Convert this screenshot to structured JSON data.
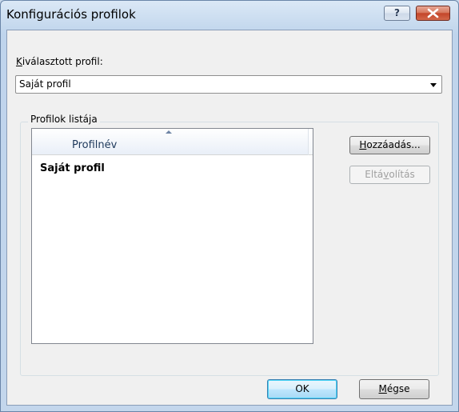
{
  "window": {
    "title": "Konfigurációs profilok",
    "help_label": "?",
    "close_icon": "close-x-icon"
  },
  "selected_profile": {
    "label_prefix": "",
    "label_underlined": "K",
    "label_rest": "iválasztott profil:",
    "value": "Saját profil"
  },
  "profiles_group": {
    "legend": "Profilok listája",
    "column_header": "Profilnév",
    "sort_direction": "ascending",
    "rows": [
      "Saját profil"
    ]
  },
  "buttons": {
    "add": {
      "underlined": "H",
      "rest": "ozzáadás...",
      "enabled": true
    },
    "remove": {
      "prefix": "Eltá",
      "underlined": "v",
      "rest": "olítás",
      "enabled": false
    },
    "ok": "OK",
    "cancel": {
      "underlined": "M",
      "rest": "égse"
    }
  },
  "colors": {
    "close_button": "#c4452a",
    "default_button_border": "#3c7fb1",
    "disabled_text": "#a0a0a0"
  }
}
